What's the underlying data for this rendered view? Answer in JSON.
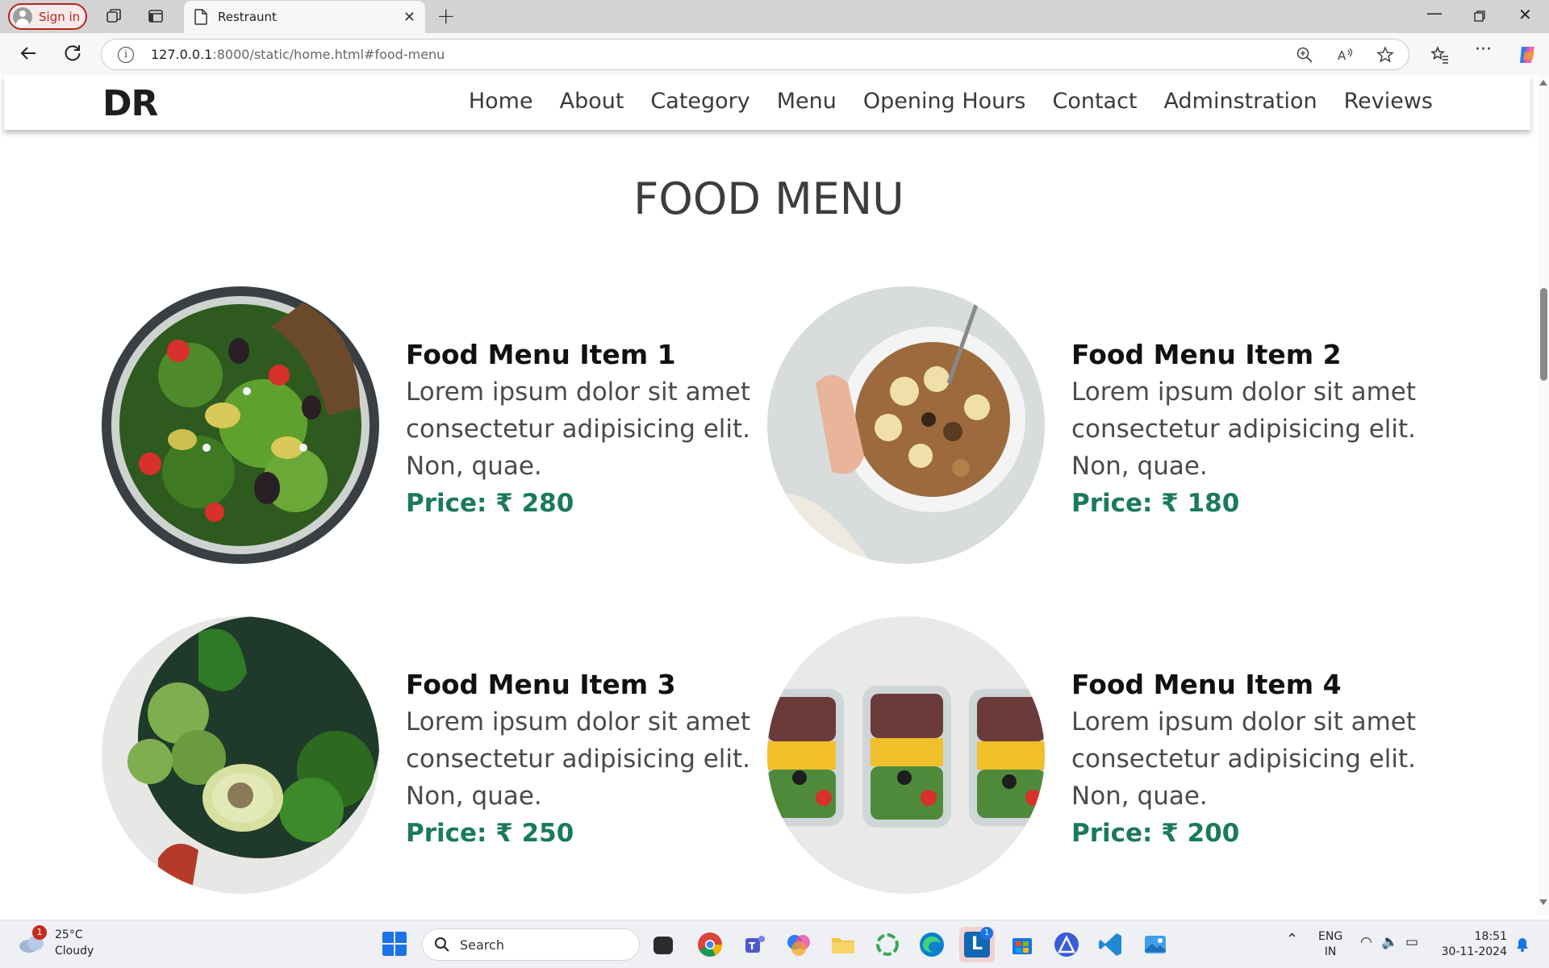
{
  "browser": {
    "signin_label": "Sign in",
    "tab_title": "Restraunt",
    "url_host": "127.0.0.1",
    "url_rest": ":8000/static/home.html#food-menu"
  },
  "site": {
    "logo": "DR",
    "nav": [
      "Home",
      "About",
      "Category",
      "Menu",
      "Opening Hours",
      "Contact",
      "Adminstration",
      "Reviews"
    ],
    "section_title": "FOOD MENU",
    "items": [
      {
        "title": "Food Menu Item 1",
        "desc": "Lorem ipsum dolor sit amet consectetur adipisicing elit. Non, quae.",
        "price": "Price: ₹ 280",
        "image": "salad-bowl"
      },
      {
        "title": "Food Menu Item 2",
        "desc": "Lorem ipsum dolor sit amet consectetur adipisicing elit. Non, quae.",
        "price": "Price: ₹ 180",
        "image": "granola-bowl"
      },
      {
        "title": "Food Menu Item 3",
        "desc": "Lorem ipsum dolor sit amet consectetur adipisicing elit. Non, quae.",
        "price": "Price: ₹ 250",
        "image": "green-vegetables"
      },
      {
        "title": "Food Menu Item 4",
        "desc": "Lorem ipsum dolor sit amet consectetur adipisicing elit. Non, quae.",
        "price": "Price: ₹ 200",
        "image": "meal-prep-boxes"
      }
    ],
    "accent_color": "#1b7a5c"
  },
  "taskbar": {
    "weather_temp": "25°C",
    "weather_desc": "Cloudy",
    "weather_badge": "1",
    "search_placeholder": "Search",
    "lang_1": "ENG",
    "lang_2": "IN",
    "time": "18:51",
    "date": "30-11-2024",
    "app_badge": "1"
  }
}
